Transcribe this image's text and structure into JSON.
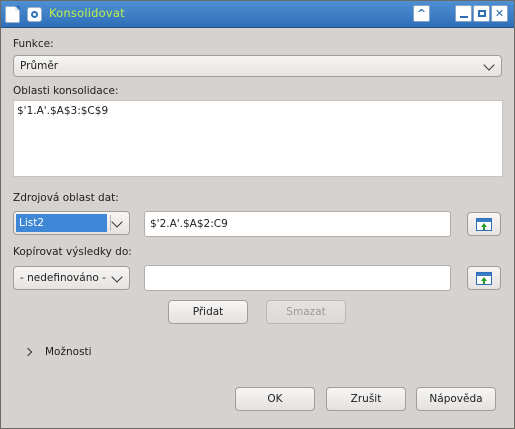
{
  "window": {
    "title": "Konsolidovat",
    "buttons": {
      "shade": "^",
      "close": "✕"
    }
  },
  "function": {
    "label": "Funkce:",
    "value": "Průměr"
  },
  "consolidation_ranges": {
    "label": "Oblasti konsolidace:",
    "items": [
      "$'1.A'.$A$3:$C$9"
    ]
  },
  "source_range": {
    "label": "Zdrojová oblast dat:",
    "selector_value": "List2",
    "input_value": "$'2.A'.$A$2:C9"
  },
  "copy_results": {
    "label": "Kopírovat výsledky do:",
    "selector_value": "- nedefinováno -",
    "input_value": ""
  },
  "actions": {
    "add": "Přidat",
    "delete": "Smazat"
  },
  "options": {
    "label": "Možnosti"
  },
  "footer": {
    "ok": "OK",
    "cancel": "Zrušit",
    "help": "Nápověda"
  }
}
